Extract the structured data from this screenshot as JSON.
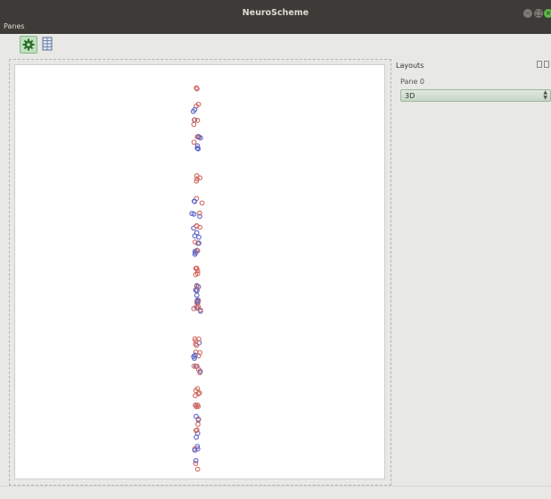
{
  "window": {
    "title": "NeuroScheme",
    "menu": "Panes"
  },
  "toolbar": {
    "buttons": [
      {
        "name": "settings",
        "icon": "gear-icon",
        "active": true
      },
      {
        "name": "layout",
        "icon": "grid-icon",
        "active": false
      }
    ]
  },
  "side_panel": {
    "title": "Layouts",
    "pane_label": "Pane 0",
    "layout_select": {
      "value": "3D"
    }
  },
  "viewport": {
    "description_colors": {
      "red": "#d06a60",
      "blue": "#5b64c8"
    }
  }
}
